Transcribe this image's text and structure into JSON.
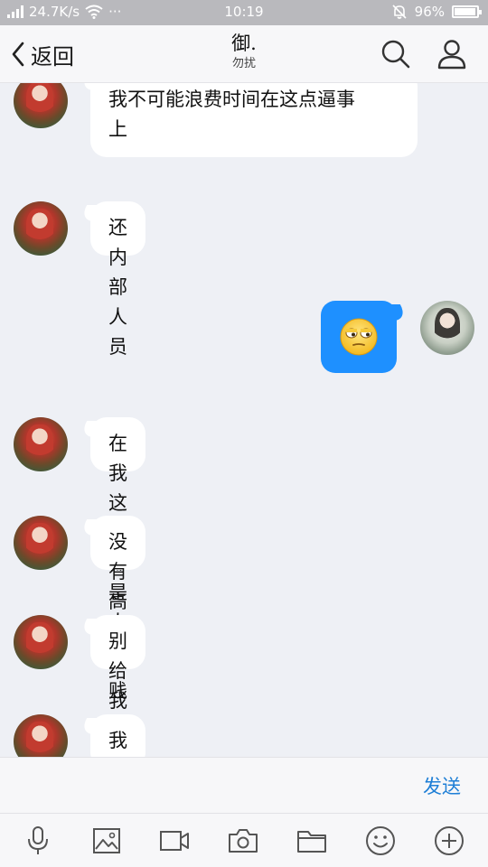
{
  "status_bar": {
    "network_speed": "24.7K/s",
    "dots": "···",
    "time": "10:19",
    "battery_percent": "96%",
    "battery_level": 0.96
  },
  "header": {
    "back_label": "返回",
    "title": "御.",
    "subtitle": "勿扰"
  },
  "messages": [
    {
      "side": "left",
      "text": "我不可能浪费时间在这点逼事\n上"
    },
    {
      "side": "left",
      "text": "还内部人员"
    },
    {
      "side": "right",
      "emoji": "rolling-eyes-emoji"
    },
    {
      "side": "left",
      "text": "在我这里都是人"
    },
    {
      "side": "left",
      "text": "没有高低贵贱"
    },
    {
      "side": "left",
      "text": "别给我摆架子"
    },
    {
      "side": "left",
      "text": "我不吃这一套"
    }
  ],
  "input": {
    "send_label": "发送"
  },
  "toolbar": [
    "microphone-icon",
    "image-icon",
    "video-icon",
    "camera-icon",
    "folder-icon",
    "emoji-icon",
    "plus-icon"
  ],
  "colors": {
    "accent_blue": "#1e90ff",
    "send_blue": "#1f7fd6",
    "chat_bg": "#eef0f5"
  }
}
